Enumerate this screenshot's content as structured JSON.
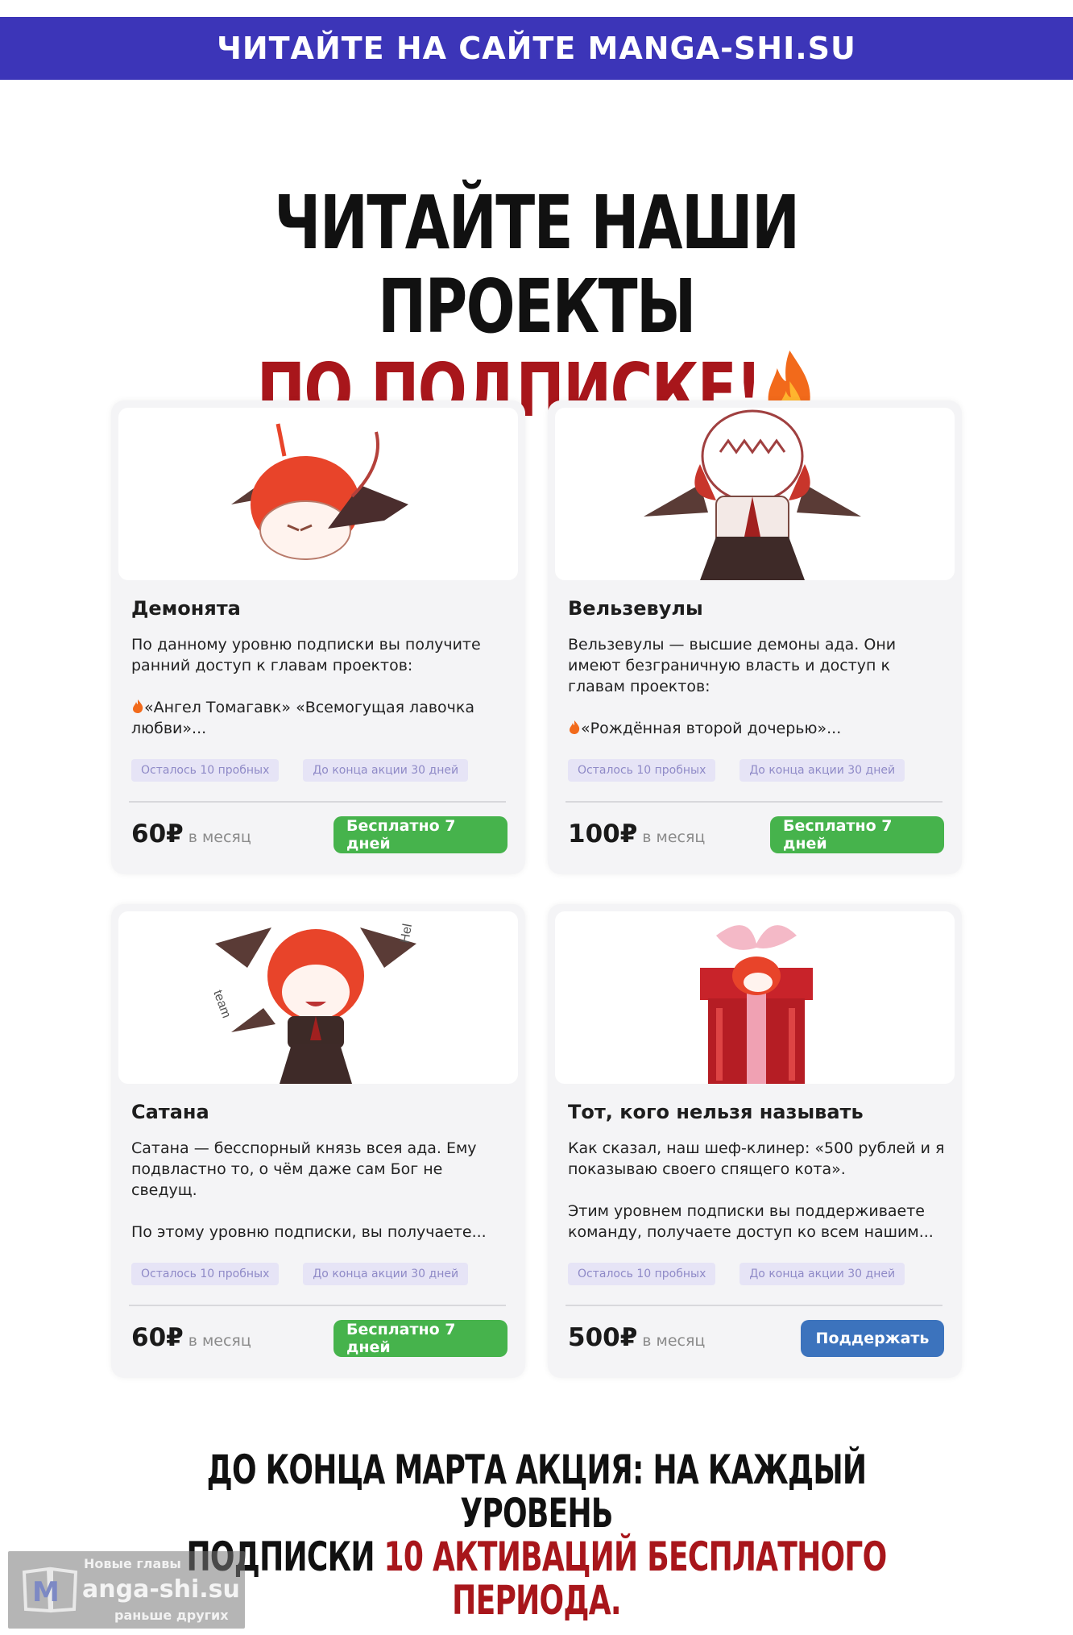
{
  "banner": {
    "text": "ЧИТАЙТЕ НА САЙТЕ MANGA-SHI.SU"
  },
  "headline": {
    "line1": "ЧИТАЙТЕ НАШИ ПРОЕКТЫ",
    "line2": "ПО ПОДПИСКЕ!"
  },
  "cards": [
    {
      "title": "Демонята",
      "description": "По данному уровню подписки вы получите ранний доступ к главам проектов:",
      "projects": "«Ангел Томагавк» «Всемогущая лавочка любви»...",
      "tag_trials": "Осталось 10 пробных",
      "tag_promo": "До конца акции 30 дней",
      "price": "60₽",
      "period": "в месяц",
      "button": "Бесплатно 7 дней"
    },
    {
      "title": "Вельзевулы",
      "description": "Вельзевулы — высшие демоны ада. Они имеют безграничную власть и доступ к главам проектов:",
      "projects": "«Рождённая второй дочерью»...",
      "tag_trials": "Осталось 10 пробных",
      "tag_promo": "До конца акции 30 дней",
      "price": "100₽",
      "period": "в месяц",
      "button": "Бесплатно 7 дней"
    },
    {
      "title": "Сатана",
      "description": "Сатана — бесспорный князь всея ада. Ему подвластно то, о чём даже сам Бог не сведущ.",
      "projects": "По этому уровню подписки, вы получаете...",
      "tag_trials": "Осталось 10 пробных",
      "tag_promo": "До конца акции 30 дней",
      "price": "60₽",
      "period": "в месяц",
      "button": "Бесплатно 7 дней"
    },
    {
      "title": "Тот, кого нельзя называть",
      "description": "Как сказал, наш шеф-клинер: «500 рублей и я показываю своего спящего кота».",
      "projects": "Этим уровнем подписки вы поддерживаете команду, получаете доступ ко всем нашим...",
      "tag_trials": "Осталось 10 пробных",
      "tag_promo": "До конца акции 30 дней",
      "price": "500₽",
      "period": "в месяц",
      "button": "Поддержать"
    }
  ],
  "promo": {
    "line1": "ДО КОНЦА МАРТА АКЦИЯ: НА КАЖДЫЙ УРОВЕНЬ",
    "line2_prefix": "ПОДПИСКИ ",
    "line2_highlight": "10 АКТИВАЦИЙ БЕСПЛАТНОГО ПЕРИОДА."
  },
  "watermark": {
    "top": "Новые главы",
    "site": "anga-shi.su",
    "bottom": "раньше других"
  },
  "colors": {
    "banner": "#3c35b8",
    "headline_red": "#a8161b",
    "button_green": "#46b34c",
    "button_blue": "#3c73bd",
    "tag_bg": "#e6e4f6",
    "tag_text": "#8f8ac7"
  },
  "icons": [
    "fire-icon",
    "manga-logo-icon"
  ]
}
